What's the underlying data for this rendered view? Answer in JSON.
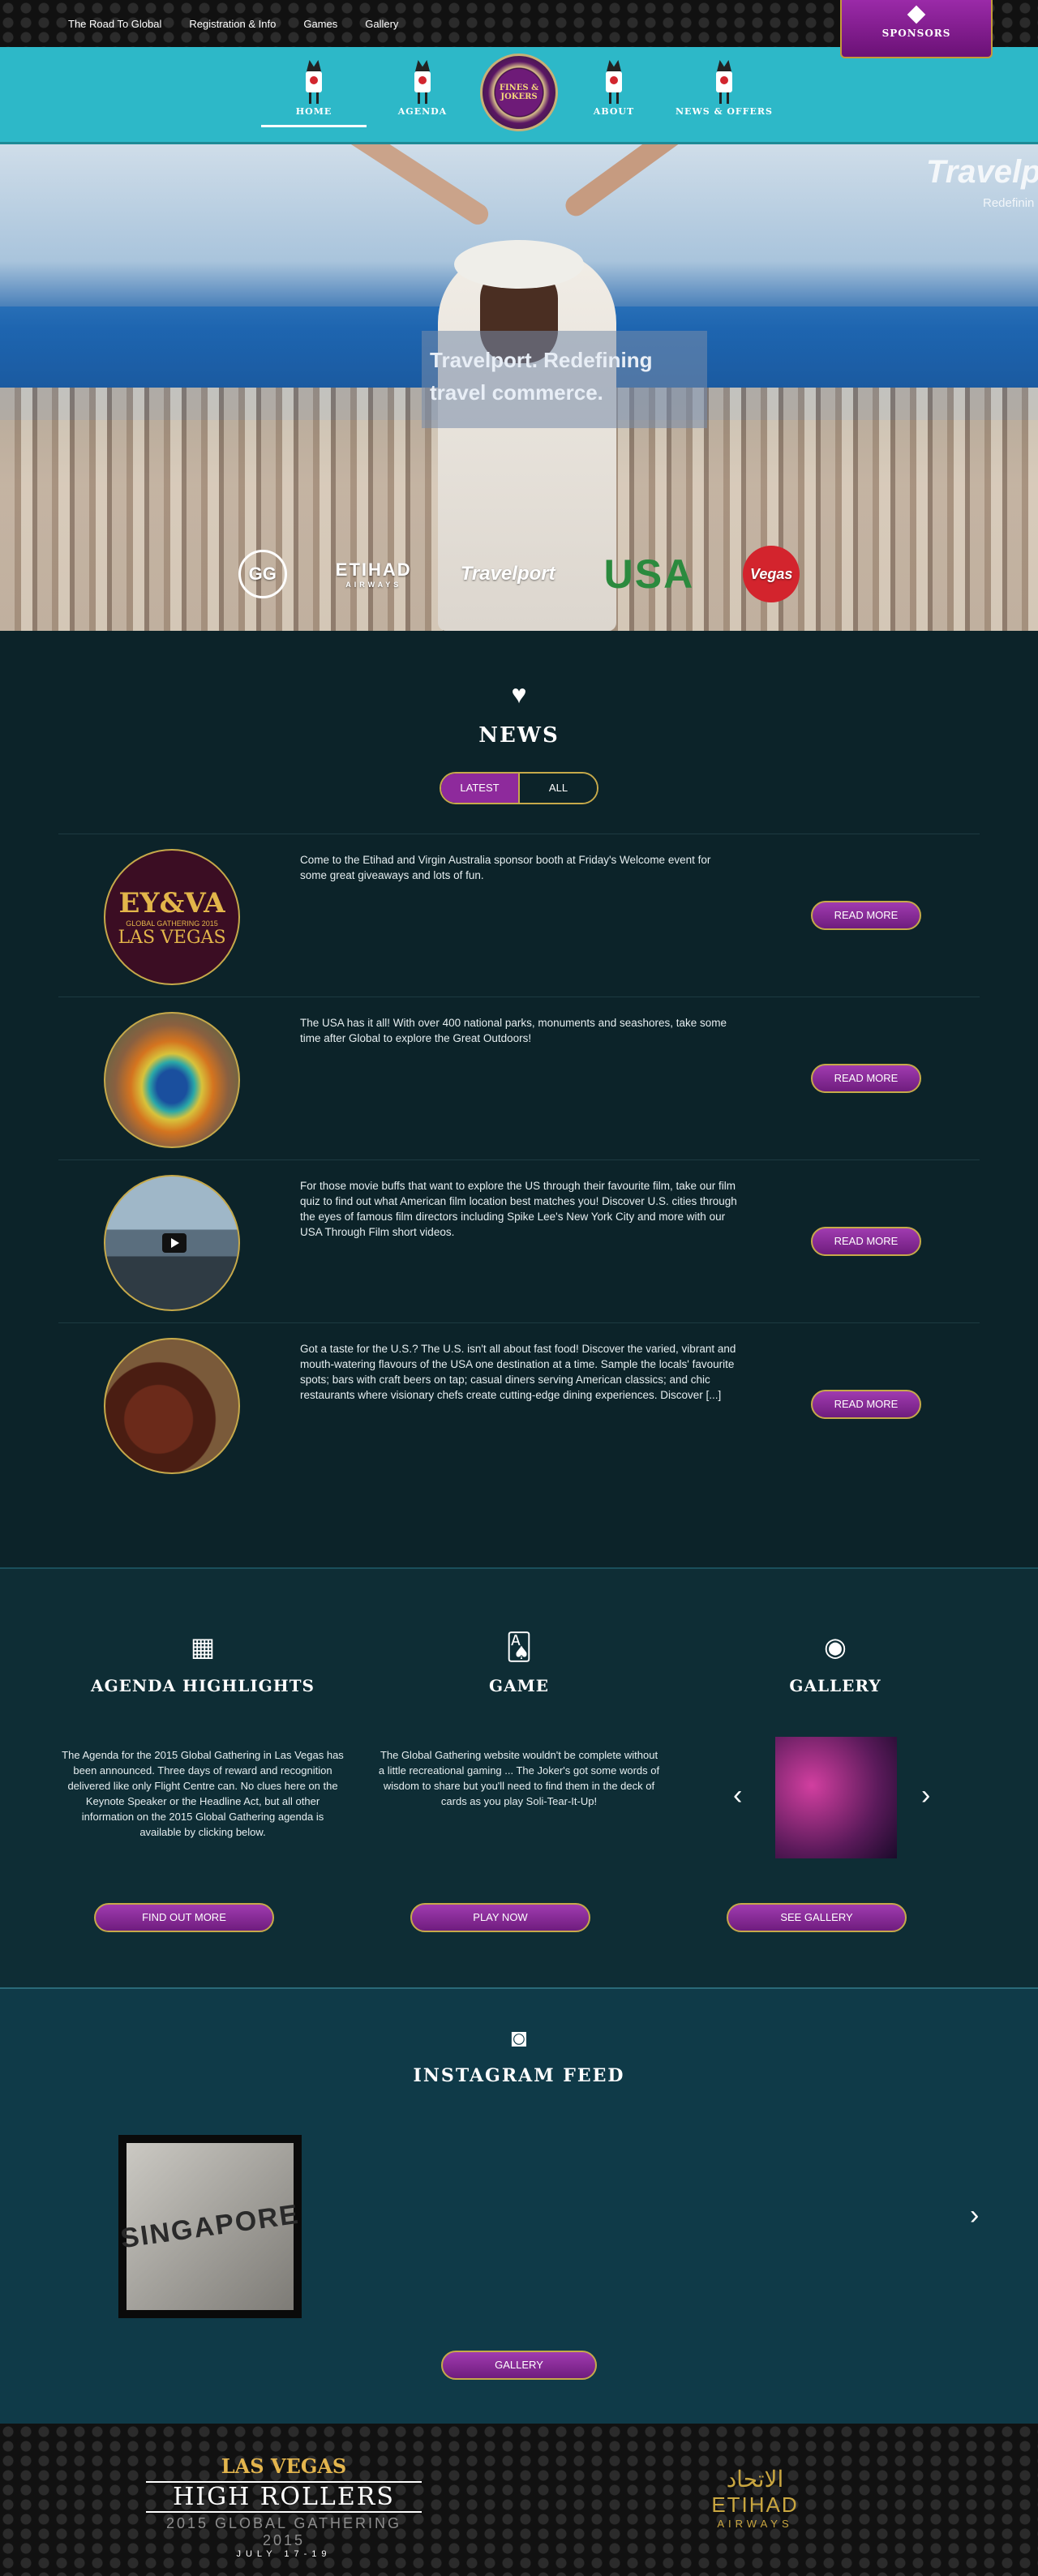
{
  "topnav": {
    "items": [
      "The Road To Global",
      "Registration & Info",
      "Games",
      "Gallery"
    ]
  },
  "sponsors": {
    "label": "SPONSORS"
  },
  "mainnav": {
    "items": [
      {
        "label": "HOME"
      },
      {
        "label": "AGENDA"
      },
      {
        "label": "ABOUT"
      },
      {
        "label": "NEWS & OFFERS"
      }
    ],
    "logo_text": "FINES & JOKERS"
  },
  "hero": {
    "tagline_line1": "Travelport. Redefining",
    "tagline_line2": "travel commerce.",
    "corner_brand": "Travelp",
    "corner_sub": "Redefinin",
    "partners": {
      "p1": "GG",
      "etihad": "ETIHAD",
      "etihad_sub": "AIRWAYS",
      "travelport": "Travelport",
      "usa": "USA",
      "vegas": "Vegas"
    }
  },
  "news": {
    "title": "NEWS",
    "tabs": {
      "latest": "LATEST",
      "all": "ALL"
    },
    "read_more": "READ MORE",
    "thumb1": {
      "big": "EY&VA",
      "small": "GLOBAL GATHERING 2015",
      "lv": "LAS VEGAS"
    },
    "items": [
      "Come to the Etihad and Virgin Australia sponsor booth at Friday's Welcome event for some great giveaways and lots of fun.",
      "The USA has it all! With over 400 national parks, monuments and seashores, take some time after Global to explore the Great Outdoors!",
      "For those movie buffs that want to explore the US through their favourite film, take our film quiz to find out what American film location best matches you! Discover U.S. cities through the eyes of famous film directors including Spike Lee's New York City and more with our USA Through Film short videos.",
      "Got a taste for the U.S.? The U.S. isn't all about fast food! Discover the varied, vibrant and mouth-watering flavours of the USA one destination at a time. Sample the locals' favourite spots; bars with craft beers on tap; casual diners serving American classics; and chic restaurants where visionary chefs create cutting-edge dining experiences. Discover [...]"
    ]
  },
  "highlights": {
    "agenda": {
      "title": "AGENDA HIGHLIGHTS",
      "text": "The Agenda for the 2015 Global Gathering in Las Vegas has been announced. Three days of reward and recognition delivered like only Flight Centre can. No clues here on the Keynote Speaker or the Headline Act, but all other information on the 2015 Global Gathering agenda is available by clicking below.",
      "button": "FIND OUT MORE"
    },
    "game": {
      "title": "GAME",
      "text": "The Global Gathering website wouldn't be complete without a little recreational gaming ... The Joker's got some words of wisdom to share but you'll need to find them in the deck of cards as you play Soli-Tear-It-Up!",
      "button": "PLAY NOW"
    },
    "gallery": {
      "title": "GALLERY",
      "button": "SEE GALLERY"
    }
  },
  "instagram": {
    "title": "INSTAGRAM FEED",
    "image_text": "SINGAPORE",
    "button": "GALLERY"
  },
  "footer": {
    "line1": "LAS VEGAS",
    "line2": "HIGH ROLLERS",
    "line3": "2015 GLOBAL GATHERING 2015",
    "line4": "JULY 17-19",
    "etihad_ar": "الاتحاد",
    "etihad_en": "ETIHAD",
    "etihad_sub": "AIRWAYS"
  }
}
